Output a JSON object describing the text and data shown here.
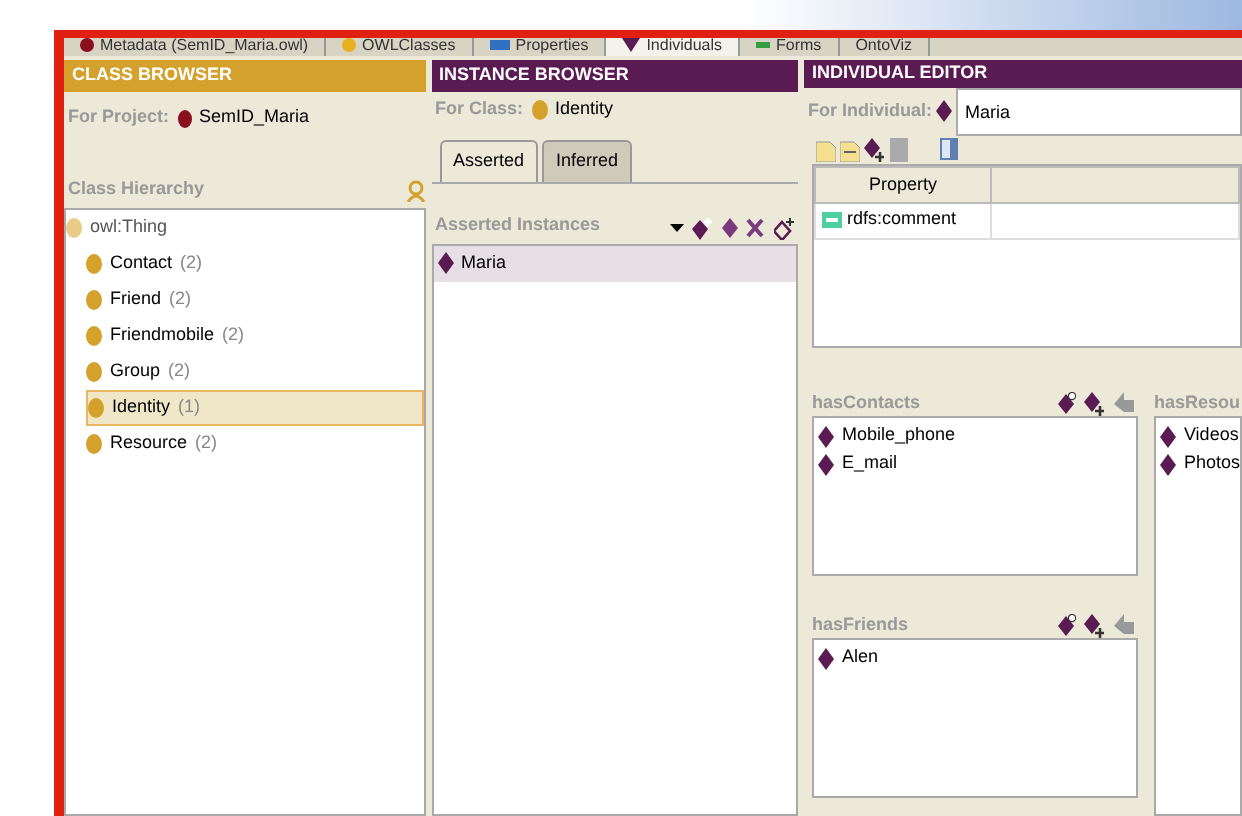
{
  "top_tabs": [
    {
      "label": "Metadata (SemID_Maria.owl)",
      "kind": "metadata",
      "selected": false
    },
    {
      "label": "OWLClasses",
      "kind": "classes",
      "selected": false
    },
    {
      "label": "Properties",
      "kind": "properties",
      "selected": false
    },
    {
      "label": "Individuals",
      "kind": "individuals",
      "selected": true
    },
    {
      "label": "Forms",
      "kind": "forms",
      "selected": false
    },
    {
      "label": "OntoViz",
      "kind": "plain",
      "selected": false
    }
  ],
  "class_browser": {
    "title": "CLASS BROWSER",
    "project_label": "For Project:",
    "project": "SemID_Maria",
    "hierarchy_title": "Class Hierarchy",
    "tree": {
      "label": "owl:Thing",
      "children": [
        {
          "label": "Contact",
          "count": "(2)",
          "selected": false
        },
        {
          "label": "Friend",
          "count": "(2)",
          "selected": false
        },
        {
          "label": "Friendmobile",
          "count": "(2)",
          "selected": false
        },
        {
          "label": "Group",
          "count": "(2)",
          "selected": false
        },
        {
          "label": "Identity",
          "count": "(1)",
          "selected": true
        },
        {
          "label": "Resource",
          "count": "(2)",
          "selected": false
        }
      ]
    }
  },
  "instance_browser": {
    "title": "INSTANCE BROWSER",
    "class_label": "For Class:",
    "class_name": "Identity",
    "tabs": [
      {
        "label": "Asserted",
        "selected": true
      },
      {
        "label": "Inferred",
        "selected": false
      }
    ],
    "section_title": "Asserted Instances",
    "instances": [
      {
        "label": "Maria",
        "selected": true
      }
    ]
  },
  "individual_editor": {
    "title": "INDIVIDUAL EDITOR",
    "individual_label": "For Individual:",
    "individual": "Maria",
    "table": {
      "columns": [
        "Property"
      ],
      "rows": [
        {
          "property": "rdfs:comment"
        }
      ]
    },
    "slots": [
      {
        "name": "hasContacts",
        "values": [
          "Mobile_phone",
          "E_mail"
        ]
      },
      {
        "name": "hasResou",
        "values": [
          "Videos",
          "Photos"
        ]
      },
      {
        "name": "hasFriends",
        "values": [
          "Alen"
        ]
      }
    ]
  }
}
